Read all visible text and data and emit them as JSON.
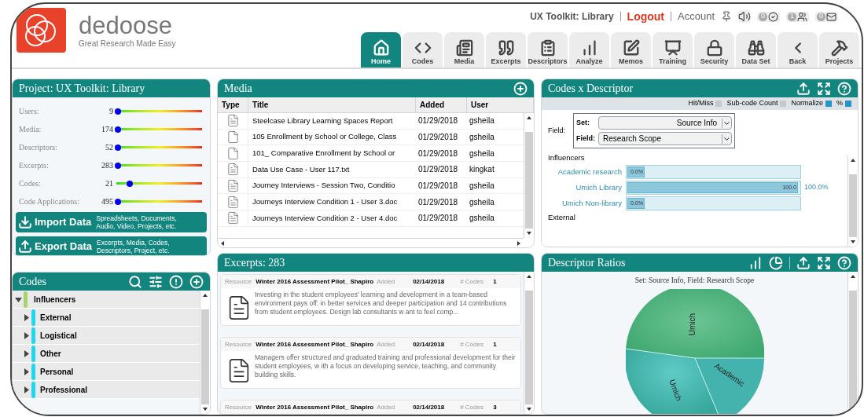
{
  "logo": {
    "name": "dedoose",
    "tagline": "Great Research Made Easy"
  },
  "top_links": {
    "project": "UX Toolkit: Library",
    "logout": "Logout",
    "account": "Account",
    "badges": [
      "0",
      "1",
      "0"
    ]
  },
  "tabs": [
    {
      "label": "Home",
      "selected": true
    },
    {
      "label": "Codes",
      "selected": false
    },
    {
      "label": "Media",
      "selected": false
    },
    {
      "label": "Excerpts",
      "selected": false
    },
    {
      "label": "Descriptors",
      "selected": false
    },
    {
      "label": "Analyze",
      "selected": false
    },
    {
      "label": "Memos",
      "selected": false
    },
    {
      "label": "Training",
      "selected": false
    },
    {
      "label": "Security",
      "selected": false
    },
    {
      "label": "Data Set",
      "selected": false
    },
    {
      "label": "Back",
      "selected": false
    },
    {
      "label": "Projects",
      "selected": false
    }
  ],
  "project": {
    "title": "Project: UX Toolkit: Library",
    "stats": [
      {
        "label": "Users:",
        "value": "9",
        "level": 0
      },
      {
        "label": "Media:",
        "value": "174",
        "level": 0
      },
      {
        "label": "Descriptors:",
        "value": "52",
        "level": 0
      },
      {
        "label": "Excerpts:",
        "value": "283",
        "level": 0
      },
      {
        "label": "Codes:",
        "value": "21",
        "level": 0.14
      },
      {
        "label": "Code Applications:",
        "value": "495",
        "level": 0
      }
    ],
    "actions": [
      {
        "kind": "import",
        "label": "Import Data",
        "description": "Spreadsheets, Documents, Audio, Video, Projects, etc."
      },
      {
        "kind": "export",
        "label": "Export Data",
        "description": "Excerpts, Media, Codes, Descriptors, Project, etc."
      }
    ]
  },
  "codes": {
    "title": "Codes",
    "tree": [
      {
        "label": "Influencers",
        "expanded": true,
        "color": "#a6d36a",
        "children": [
          {
            "label": "External",
            "expanded": false,
            "color": "#1fd8f0"
          },
          {
            "label": "Logistical",
            "expanded": false,
            "color": "#1fd8f0"
          },
          {
            "label": "Other",
            "expanded": false,
            "color": "#1fd8f0"
          },
          {
            "label": "Personal",
            "expanded": false,
            "color": "#1fd8f0"
          },
          {
            "label": "Professional",
            "expanded": false,
            "color": "#1fd8f0"
          }
        ]
      }
    ]
  },
  "media": {
    "title": "Media",
    "columns": [
      "Type",
      "Title",
      "Added",
      "User"
    ],
    "rows": [
      {
        "kind": "doc",
        "title": "Steelcase Library Learning Spaces Report",
        "added": "01/29/2018",
        "user": "gsheila"
      },
      {
        "kind": "pdf",
        "title": "105 Enrollment by School or College, Class",
        "added": "01/29/2018",
        "user": "gsheila"
      },
      {
        "kind": "pdf",
        "title": "101_ Comparative Enrollment by School or",
        "added": "01/29/2018",
        "user": "gsheila"
      },
      {
        "kind": "doc",
        "title": "Data Use Case - User 117.txt",
        "added": "01/29/2018",
        "user": "kingkat"
      },
      {
        "kind": "doc",
        "title": "Journey Interviews - Session Two, Conditio",
        "added": "01/29/2018",
        "user": "gsheila"
      },
      {
        "kind": "doc",
        "title": "Journeys Interview Condition 1 - User 3.doc",
        "added": "01/29/2018",
        "user": "gsheila"
      },
      {
        "kind": "doc",
        "title": "Journeys Interview Condition 2 - User 4.doc",
        "added": "01/29/2018",
        "user": "gsheila"
      }
    ]
  },
  "excerpts": {
    "title": "Excerpts: 283",
    "items": [
      {
        "resource_label": "Resource",
        "resource": "Winter 2016 Assessment Pilot_ Shapiro",
        "added_label": "Added",
        "added": "02/14/2018",
        "codes_label": "# Codes",
        "codes": "1",
        "text": "Investing in the student employees' learning and development in a team-based environment pays off: in better services and deeper participation and 14 contributions from student employees. Design lab consultants w ant to feel comp..."
      },
      {
        "resource_label": "Resource",
        "resource": "Winter 2016 Assessment Pilot_ Shapiro",
        "added_label": "Added",
        "added": "02/14/2018",
        "codes_label": "# Codes",
        "codes": "1",
        "text": "Managers offer structured and graduated training and professional development for their student employees, w ith a focus on developing service, teaching, and community building skills."
      },
      {
        "resource_label": "Resource",
        "resource": "Winter 2016 Assessment Pilot_ Shapiro",
        "added_label": "Added",
        "added": "02/14/2018",
        "codes_label": "# Codes",
        "codes": "3"
      }
    ]
  },
  "codes_x_descriptor": {
    "title": "Codes x Descriptor",
    "options": [
      {
        "label": "Hit/Miss",
        "checked": false
      },
      {
        "label": "Sub-code Count",
        "checked": false
      },
      {
        "label": "Normalize",
        "checked": true
      },
      {
        "label": "%",
        "checked": true
      }
    ],
    "field_label": "Field:",
    "set_label": "Set:",
    "set_value": "Source Info",
    "field_select_label": "Field:",
    "field_value": "Research Scope",
    "groups": [
      {
        "label": "Influencers",
        "bars": [
          {
            "label": "Academic research",
            "level": 0,
            "bar_text": "0.0%"
          },
          {
            "label": "Umich Library",
            "level": 1,
            "bar_text": "100.0",
            "total": "100.0%"
          },
          {
            "label": "Umich Non-library",
            "level": 0,
            "bar_text": "0.0%"
          }
        ]
      },
      {
        "label": "External"
      }
    ]
  },
  "descriptor_ratios": {
    "title": "Descriptor Ratios",
    "subtitle": "Set: Source Info, Field: Research Scope",
    "slice_labels": [
      "Umich",
      "Umich",
      "Academic"
    ]
  }
}
